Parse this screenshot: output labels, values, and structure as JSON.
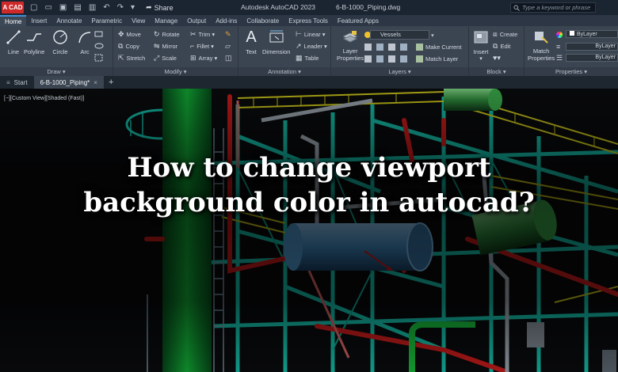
{
  "titlebar": {
    "logo_text": "A CAD",
    "share_label": "Share",
    "app_title": "Autodesk AutoCAD 2023",
    "file_title": "6-B-1000_Piping.dwg",
    "search_placeholder": "Type a keyword or phrase"
  },
  "ribbon_tabs": [
    "Home",
    "Insert",
    "Annotate",
    "Parametric",
    "View",
    "Manage",
    "Output",
    "Add-ins",
    "Collaborate",
    "Express Tools",
    "Featured Apps"
  ],
  "ribbon": {
    "draw": {
      "label": "Draw ▾",
      "line": "Line",
      "polyline": "Polyline",
      "circle": "Circle",
      "arc": "Arc"
    },
    "modify": {
      "label": "Modify ▾",
      "move": "Move",
      "rotate": "Rotate",
      "trim": "Trim ▾",
      "copy": "Copy",
      "mirror": "Mirror",
      "fillet": "Fillet ▾",
      "stretch": "Stretch",
      "scale": "Scale",
      "array": "Array ▾"
    },
    "annotation": {
      "label": "Annotation ▾",
      "text": "Text",
      "dimension": "Dimension",
      "linear": "Linear ▾",
      "leader": "Leader ▾",
      "table": "Table"
    },
    "layers": {
      "label": "Layers ▾",
      "properties_line1": "Layer",
      "properties_line2": "Properties",
      "current_layer": "Vessels",
      "make_current": "Make Current",
      "match_layer": "Match Layer"
    },
    "block": {
      "label": "Block ▾",
      "insert": "Insert",
      "create": "Create",
      "edit": "Edit"
    },
    "properties": {
      "label": "Properties ▾",
      "match_line1": "Match",
      "match_line2": "Properties",
      "color": "ByLayer",
      "linetype": "ByLayer",
      "lineweight": "ByLayer"
    }
  },
  "doc_tabs": {
    "start": "Start",
    "active": "6-B-1000_Piping*",
    "close_glyph": "×",
    "add_glyph": "+"
  },
  "viewport": {
    "label": "[−][Custom View][Shaded (Fast)]",
    "headline_line1": "How to change viewport",
    "headline_line2": "background color in autocad?"
  },
  "colors": {
    "titlebar": "#1b2431",
    "ribbon": "#3b4552",
    "accent": "#3e8fd6",
    "pipe_green": "#0f9a2c",
    "structure_cyan": "#15b9a5",
    "railing_yellow": "#c8c21a",
    "pipe_red": "#c41b1b",
    "vessel_blue": "#3f86bd"
  }
}
